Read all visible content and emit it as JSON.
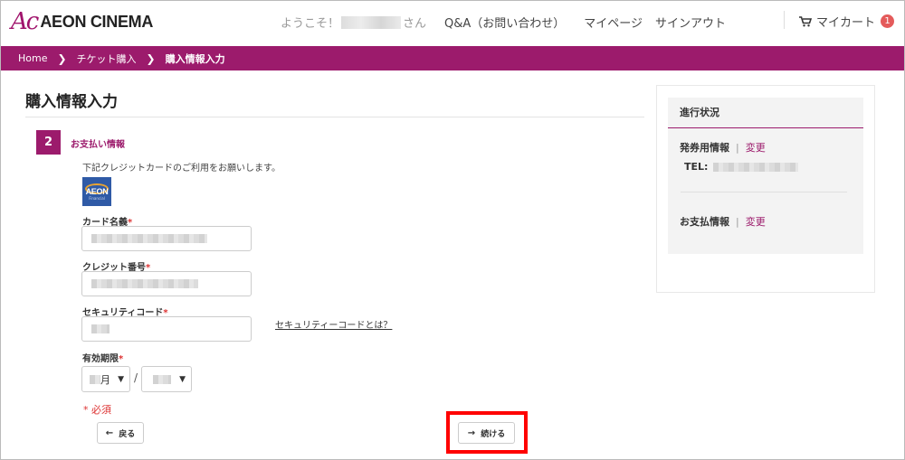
{
  "header": {
    "logo_mark": "Ac",
    "logo_text": "AEON CINEMA",
    "welcome_prefix": "ようこそ！",
    "welcome_suffix": "さん",
    "qa": "Q&A（お問い合わせ）",
    "mypage": "マイページ",
    "signout": "サインアウト",
    "cart_label": "マイカート",
    "cart_count": "1"
  },
  "breadcrumb": {
    "items": [
      "Home",
      "チケット購入",
      "購入情報入力"
    ],
    "separator": ">"
  },
  "main": {
    "title": "購入情報入力",
    "step_number": "2",
    "step_label": "お支払い情報",
    "intro": "下記クレジットカードのご利用をお願いします。",
    "card_brand": "AEON",
    "card_brand_sub": "Financial",
    "card_name_label": "カード名義",
    "card_number_label": "クレジット番号",
    "security_label": "セキュリティコード",
    "security_link": "セキュリティーコードとは？",
    "expiry_label": "有効期限",
    "expiry_month_unit": "月",
    "expiry_separator": "/",
    "required_mark": "*",
    "required_note": "* 必須",
    "back_button": "戻る",
    "continue_button": "続ける"
  },
  "side": {
    "heading": "進行状況",
    "ticket_info": "発券用情報",
    "payment_info": "お支払情報",
    "change": "変更",
    "divider": "|",
    "tel_label": "TEL:"
  },
  "colors": {
    "brand": "#9c1b6c",
    "required": "#dd3333",
    "highlight": "#ff0000",
    "badge": "#e45b5b"
  },
  "icons": {
    "cart": "shopping-cart",
    "breadcrumb_separator": "chevron-right",
    "back": "arrow-left",
    "continue": "arrow-right",
    "dropdown": "caret-down"
  }
}
